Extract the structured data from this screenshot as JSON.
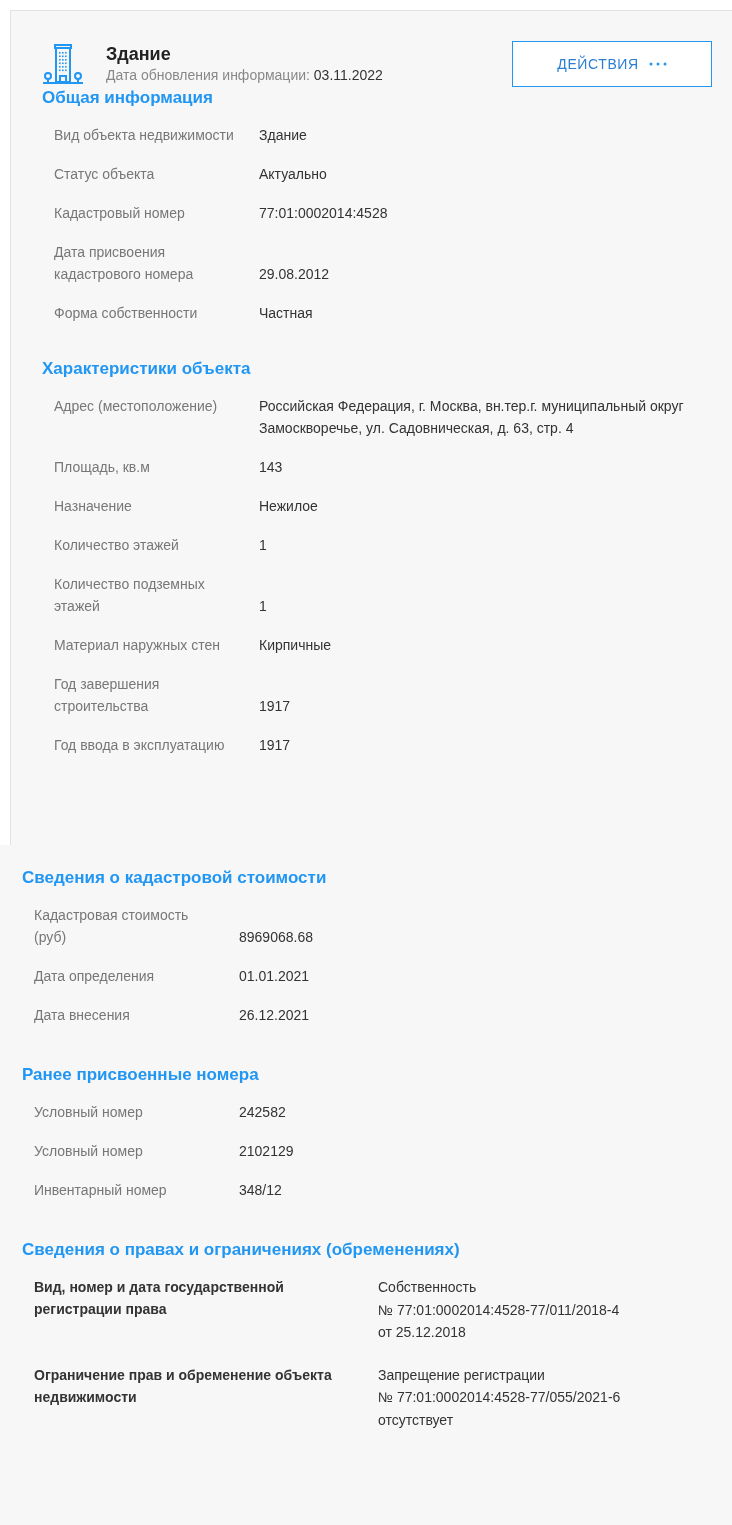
{
  "header": {
    "title": "Здание",
    "updated_label": "Дата обновления информации:",
    "updated_date": "03.11.2022"
  },
  "action_button": {
    "label": "ДЕЙСТВИЯ"
  },
  "panels": [
    {
      "sections": [
        {
          "title": "Общая информация",
          "kind": "plain",
          "rows": [
            {
              "label": "Вид объекта недвижимости",
              "value": "Здание"
            },
            {
              "label": "Статус объекта",
              "value": "Актуально"
            },
            {
              "label": "Кадастровый номер",
              "value": "77:01:0002014:4528"
            },
            {
              "label": "Дата присвоения кадастрового номера",
              "value": "29.08.2012"
            },
            {
              "label": "Форма собственности",
              "value": "Частная"
            }
          ]
        },
        {
          "title": "Характеристики объекта",
          "kind": "plain",
          "rows": [
            {
              "label": "Адрес (местоположение)",
              "value": "Российская Федерация, г. Москва, вн.тер.г. муниципальный округ Замоскворечье, ул. Садовническая, д. 63, стр. 4"
            },
            {
              "label": "Площадь, кв.м",
              "value": "143"
            },
            {
              "label": "Назначение",
              "value": "Нежилое"
            },
            {
              "label": "Количество этажей",
              "value": "1"
            },
            {
              "label": "Количество подземных этажей",
              "value": "1"
            },
            {
              "label": "Материал наружных стен",
              "value": "Кирпичные"
            },
            {
              "label": "Год завершения строительства",
              "value": "1917"
            },
            {
              "label": "Год ввода в эксплуатацию",
              "value": "1917"
            }
          ]
        }
      ]
    },
    {
      "sections": [
        {
          "title": "Сведения о кадастровой стоимости",
          "kind": "plain",
          "rows": [
            {
              "label": "Кадастровая стоимость (руб)",
              "value": "8969068.68"
            },
            {
              "label": "Дата определения",
              "value": "01.01.2021"
            },
            {
              "label": "Дата внесения",
              "value": "26.12.2021"
            }
          ]
        },
        {
          "title": "Ранее присвоенные номера",
          "kind": "plain",
          "rows": [
            {
              "label": "Условный номер",
              "value": "242582"
            },
            {
              "label": "Условный номер",
              "value": "2102129"
            },
            {
              "label": "Инвентарный номер",
              "value": "348/12"
            }
          ]
        },
        {
          "title": "Сведения о правах и ограничениях (обременениях)",
          "kind": "rights",
          "rows": [
            {
              "label": "Вид, номер и дата государственной регистрации права",
              "lines": [
                "Собственность",
                "№ 77:01:0002014:4528-77/011/2018-4",
                "от 25.12.2018"
              ]
            },
            {
              "label": "Ограничение прав и обременение объекта недвижимости",
              "lines": [
                "Запрещение регистрации",
                "№ 77:01:0002014:4528-77/055/2021-6",
                "отсутствует"
              ]
            }
          ]
        }
      ]
    }
  ]
}
